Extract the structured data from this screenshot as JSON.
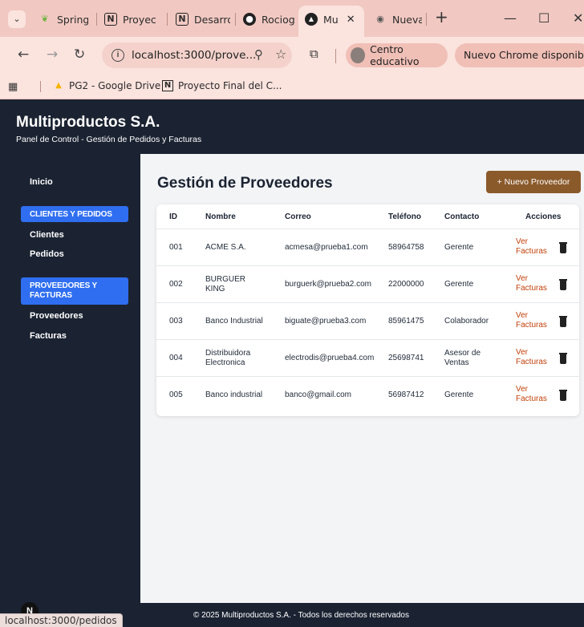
{
  "browser": {
    "tabs": [
      {
        "label": "Spring",
        "icon": "spring-leaf-icon"
      },
      {
        "label": "Proyec",
        "icon": "notion-icon"
      },
      {
        "label": "Desarro",
        "icon": "notion-icon"
      },
      {
        "label": "Rociog",
        "icon": "github-icon"
      },
      {
        "label": "Mu",
        "icon": "app-icon",
        "active": true
      },
      {
        "label": "Nueva",
        "icon": "chrome-icon"
      }
    ],
    "url": "localhost:3000/prove...",
    "profile_label": "Centro educativo",
    "update_label": "Nuevo Chrome disponible",
    "bookmarks": [
      {
        "label": "PG2 - Google Drive",
        "icon": "google-drive-icon"
      },
      {
        "label": "Proyecto Final del C...",
        "icon": "notion-icon"
      }
    ],
    "status_url": "localhost:3000/pedidos"
  },
  "header": {
    "title": "Multiproductos S.A.",
    "subtitle": "Panel de Control - Gestión de Pedidos y Facturas"
  },
  "sidebar": {
    "home": "Inicio",
    "group1": "CLIENTES Y PEDIDOS",
    "group1_items": [
      "Clientes",
      "Pedidos"
    ],
    "group2": "PROVEEDORES Y FACTURAS",
    "group2_items": [
      "Proveedores",
      "Facturas"
    ]
  },
  "main": {
    "title": "Gestión de Proveedores",
    "new_button": "+ Nuevo Proveedor",
    "columns": [
      "ID",
      "Nombre",
      "Correo",
      "Teléfono",
      "Contacto",
      "Acciones"
    ],
    "rows": [
      {
        "id": "001",
        "name": "ACME S.A.",
        "email": "acmesa@prueba1.com",
        "phone": "58964758",
        "contact": "Gerente",
        "action": "Ver Facturas"
      },
      {
        "id": "002",
        "name": "BURGUER KING",
        "email": "burguerk@prueba2.com",
        "phone": "22000000",
        "contact": "Gerente",
        "action": "Ver Facturas"
      },
      {
        "id": "003",
        "name": "Banco Industrial",
        "email": "biguate@prueba3.com",
        "phone": "85961475",
        "contact": "Colaborador",
        "action": "Ver Facturas"
      },
      {
        "id": "004",
        "name": "Distribuidora Electronica",
        "email": "electrodis@prueba4.com",
        "phone": "25698741",
        "contact": "Asesor de Ventas",
        "action": "Ver Facturas"
      },
      {
        "id": "005",
        "name": "Banco industrial",
        "email": "banco@gmail.com",
        "phone": "56987412",
        "contact": "Gerente",
        "action": "Ver Facturas"
      }
    ]
  },
  "footer": {
    "text": "© 2025 Multiproductos S.A. - Todos los derechos reservados"
  },
  "colors": {
    "dark_navy": "#1b2332",
    "accent_blue": "#2f6ef0",
    "brown_button": "#8b5a2b",
    "link_orange": "#c2410c",
    "browser_frame": "#f1c9c2"
  }
}
